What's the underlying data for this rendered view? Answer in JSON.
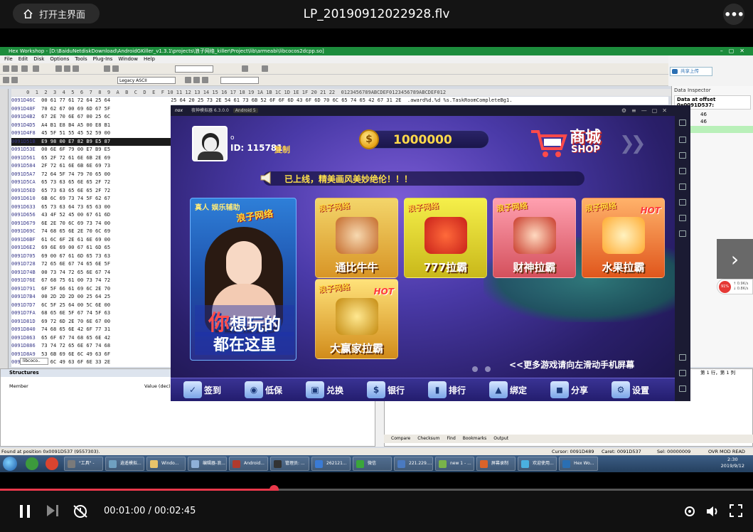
{
  "player": {
    "home_label": "打开主界面",
    "video_title": "LP_20190912022928.flv",
    "more_label": "•••",
    "time_display": "00:01:00 / 00:02:45",
    "progress": 0.3636,
    "next_arrow": "›"
  },
  "hexworkshop": {
    "title": "Hex Workshop - [D:\\BaiduNetdiskDownload\\AndroidGKiller_v1.3.1\\projects\\浪子网络_killer\\Project\\lib\\armeabi\\libcocos2dcpp.so]",
    "menu": [
      "File",
      "Edit",
      "Disk",
      "Options",
      "Tools",
      "Plug-Ins",
      "Window",
      "Help"
    ],
    "toolbar_field": "Legacy ASCII",
    "share_label": "共享上传",
    "column_header": "     0  1  2  3  4  5  6  7  8  9  A  B  C  D  E  F 10 11 12 13 14 15 16 17 18 19 1A 1B 1C 1D 1E 1F 20 21 22  0123456789ABCDEF0123456789ABCDEF012",
    "top_row": "25 64 20 25 73 2E 54 61 73 6B 52 6F 6F 6D 43 6F 6D 70 6C 65 74 65 42 67 31 2E  .award%d.%d %s.TaskRoomCompleteBg1.",
    "rows": [
      {
        "addr": "0091D46C",
        "hex": "00 61 77 61 72 64 25 64"
      },
      {
        "addr": "0091D48F",
        "hex": "70 62 67 00 69 6D 67 5F"
      },
      {
        "addr": "0091D4B2",
        "hex": "67 2E 70 6E 67 00 25 6C"
      },
      {
        "addr": "0091D4D5",
        "hex": "A4 B1 E8 B4 A5 00 E8 B1"
      },
      {
        "addr": "0091D4F8",
        "hex": "45 5F 51 55 45 52 59 00"
      },
      {
        "addr": "0091D51B",
        "hex": "E9 98 00 E7 82 B9 E5 87"
      },
      {
        "addr": "0091D53E",
        "hex": "00 6E 6F 79 00 E7 B9 E5"
      },
      {
        "addr": "0091D561",
        "hex": "65 2F 72 61 6E 6B 2E 69"
      },
      {
        "addr": "0091D584",
        "hex": "2F 72 61 6E 6B 6E 69 73"
      },
      {
        "addr": "0091D5A7",
        "hex": "72 64 5F 74 79 70 65 00"
      },
      {
        "addr": "0091D5CA",
        "hex": "65 73 63 65 6E 65 2F 72"
      },
      {
        "addr": "0091D5ED",
        "hex": "65 73 63 65 6E 65 2F 72"
      },
      {
        "addr": "0091D610",
        "hex": "6B 6C 69 73 74 5F 62 67"
      },
      {
        "addr": "0091D633",
        "hex": "65 73 63 64 73 65 63 00"
      },
      {
        "addr": "0091D656",
        "hex": "43 4F 52 45 00 67 61 6D"
      },
      {
        "addr": "0091D679",
        "hex": "6E 2E 70 6C 69 73 74 00"
      },
      {
        "addr": "0091D69C",
        "hex": "74 68 65 6E 2E 70 6C 69"
      },
      {
        "addr": "0091D6BF",
        "hex": "61 6C 6F 2E 61 6E 69 00"
      },
      {
        "addr": "0091D6E2",
        "hex": "69 6E 69 00 67 61 6D 65"
      },
      {
        "addr": "0091D705",
        "hex": "69 00 67 61 6D 65 73 63"
      },
      {
        "addr": "0091D728",
        "hex": "72 65 6E 67 74 65 6E 5F"
      },
      {
        "addr": "0091D74B",
        "hex": "00 73 74 72 65 6E 67 74"
      },
      {
        "addr": "0091D76E",
        "hex": "67 68 75 61 00 73 74 72"
      },
      {
        "addr": "0091D791",
        "hex": "6F 5F 66 61 69 6C 2E 70"
      },
      {
        "addr": "0091D7B4",
        "hex": "00 2D 2D 2D 00 25 64 25"
      },
      {
        "addr": "0091D7D7",
        "hex": "6C 5F 25 64 00 5C 6E 00"
      },
      {
        "addr": "0091D7FA",
        "hex": "68 65 6E 5F 67 74 5F 63"
      },
      {
        "addr": "0091D81D",
        "hex": "69 72 6D 2E 70 6E 67 00"
      },
      {
        "addr": "0091D840",
        "hex": "74 68 65 6E 42 6F 77 31"
      },
      {
        "addr": "0091D863",
        "hex": "65 6F 67 74 68 65 6E 42"
      },
      {
        "addr": "0091D886",
        "hex": "73 74 72 65 6E 67 74 68"
      },
      {
        "addr": "0091D8A9",
        "hex": "53 6B 69 6E 6C 49 63 6F"
      },
      {
        "addr": "0091D8CC",
        "hex": "6C 6C 49 63 6F 6E 33 2E"
      },
      {
        "addr": "0091D8EF",
        "hex": "63 6F 6E 33 2E 70 6E 67"
      }
    ],
    "file_tab": "libcoco..",
    "inspector_title": "Data Inspector",
    "inspector_head": "Data at offset 0x0091D537:",
    "inspector_values": [
      "46",
      "46"
    ],
    "structures_title": "Structures",
    "structures_col_member": "Member",
    "structures_col_value": "Value (dec)",
    "position_label": "第 1 行，第 1 列",
    "output_tabs": [
      "Compare",
      "Checksum",
      "Find",
      "Bookmarks",
      "Output"
    ],
    "status_found": "Found at position 0x0091D537 (9557303).",
    "status_cursor": "Cursor: 0091D489",
    "status_caret": "Caret: 0091D537",
    "status_sel": "Sel: 00000009",
    "status_modes": "OVR  MOD  READ",
    "cpu_pct": "91%",
    "cpu_up": "↑ 0.9K/s",
    "cpu_down": "↓ 0.8K/s"
  },
  "taskbar": {
    "items": [
      "\"工具\" -",
      "逍遥模拟...",
      "Windo...",
      "编辑器-浪...",
      "Android...",
      "管理员: ...",
      "262121...",
      "微信",
      "221.229....",
      "new 1 - ...",
      "屏幕录制",
      "欢迎使用...",
      "Hex Wo..."
    ],
    "time": "2:30",
    "date": "2019/9/12"
  },
  "emulator": {
    "logo": "nox",
    "title": "夜神模拟器 6.3.0.0",
    "android": "Android 5"
  },
  "game": {
    "player_dot": "o",
    "player_id": "ID: 115781",
    "copy_label": "复制",
    "coins": "1000000",
    "coin_symbol": "$",
    "shop_cn": "商城",
    "shop_en": "SHOP",
    "notice": "已上线，精美画风美妙绝伦！！！",
    "promo_small": "真人 娱乐辅助",
    "promo_logo": "浪子网络",
    "promo_line1_a": "你",
    "promo_line1_b": "想玩的",
    "promo_line2": "都在这里",
    "tiles": [
      {
        "tag": "浪子网络",
        "name": "通比牛牛",
        "hot": ""
      },
      {
        "tag": "浪子网络",
        "name": "777拉霸",
        "hot": ""
      },
      {
        "tag": "浪子网络",
        "name": "财神拉霸",
        "hot": ""
      },
      {
        "tag": "浪子网络",
        "name": "水果拉霸",
        "hot": "HOT"
      },
      {
        "tag": "浪子网络",
        "name": "大赢家拉霸",
        "hot": "HOT"
      }
    ],
    "swipe_hint": "<<更多游戏请向左滑动手机屏幕",
    "nav": [
      {
        "label": "签到",
        "icon": "✓"
      },
      {
        "label": "低保",
        "icon": "◉"
      },
      {
        "label": "兑换",
        "icon": "▣"
      },
      {
        "label": "银行",
        "icon": "$"
      },
      {
        "label": "排行",
        "icon": "▮"
      },
      {
        "label": "绑定",
        "icon": "▲"
      },
      {
        "label": "分享",
        "icon": "◼"
      },
      {
        "label": "设置",
        "icon": "⚙"
      }
    ]
  },
  "colors": {
    "accent": "#e8384a",
    "coin": "#ffd94a",
    "hex_title_green": "#1c8c3c"
  }
}
